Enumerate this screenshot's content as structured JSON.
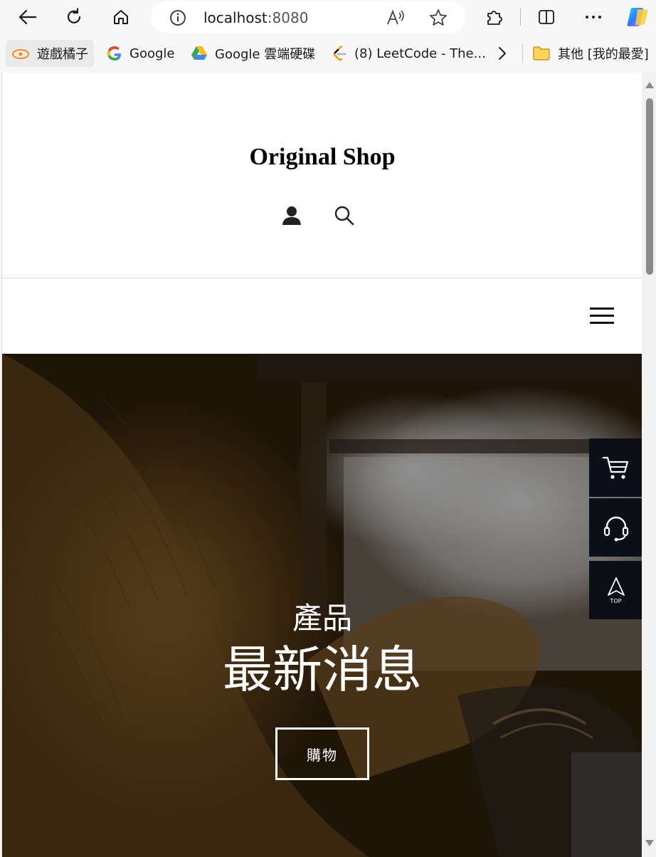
{
  "browser": {
    "address": {
      "host": "localhost",
      "port": ":8080"
    },
    "bookmarks": [
      {
        "label": "遊戲橘子",
        "icon": "gamania-icon"
      },
      {
        "label": "Google",
        "icon": "google-icon"
      },
      {
        "label": "Google 雲端硬碟",
        "icon": "google-drive-icon"
      },
      {
        "label": "(8) LeetCode - The...",
        "icon": "leetcode-icon"
      }
    ],
    "other_bookmarks": "其他 [我的最愛]"
  },
  "site": {
    "title": "Original Shop",
    "header_icons": [
      "user-icon",
      "search-icon"
    ],
    "menu_icon": "hamburger-icon"
  },
  "hero": {
    "subtitle": "產品",
    "title": "最新消息",
    "button_label": "購物"
  },
  "floating": {
    "cart_icon": "cart-icon",
    "support_icon": "headset-icon",
    "top_label": "TOP"
  }
}
